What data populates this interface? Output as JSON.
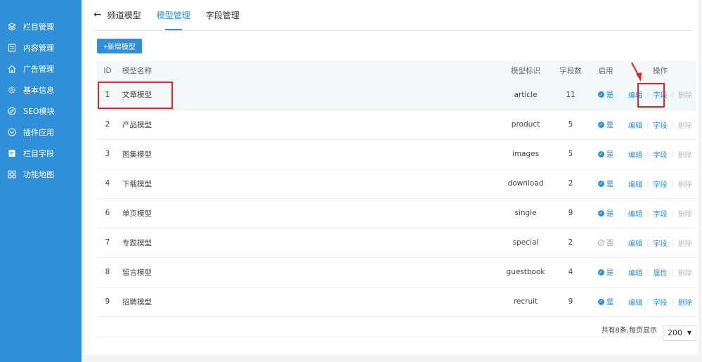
{
  "sidebar": {
    "items": [
      {
        "label": "栏目管理",
        "icon": "layers-icon"
      },
      {
        "label": "内容管理",
        "icon": "document-icon"
      },
      {
        "label": "广告管理",
        "icon": "home-icon"
      },
      {
        "label": "基本信息",
        "icon": "gear-icon"
      },
      {
        "label": "SEO模块",
        "icon": "compass-icon"
      },
      {
        "label": "插件应用",
        "icon": "plugin-icon"
      },
      {
        "label": "栏目字段",
        "icon": "file-icon"
      },
      {
        "label": "功能地图",
        "icon": "grid-icon"
      }
    ]
  },
  "header": {
    "back_label": "频道模型",
    "tabs": [
      {
        "label": "模型管理",
        "active": true
      },
      {
        "label": "字段管理",
        "active": false
      }
    ]
  },
  "toolbar": {
    "add_label": "+新增模型"
  },
  "table": {
    "columns": {
      "id": "ID",
      "name": "模型名称",
      "key": "模型标识",
      "count": "字段数",
      "enabled": "启用",
      "ops": "操作"
    },
    "rows": [
      {
        "id": "1",
        "name": "文章模型",
        "key": "article",
        "count": "11",
        "enabled": "是",
        "op1": "编辑",
        "op2": "字段",
        "op3": "删除"
      },
      {
        "id": "2",
        "name": "产品模型",
        "key": "product",
        "count": "5",
        "enabled": "是",
        "op1": "编辑",
        "op2": "字段",
        "op3": "删除"
      },
      {
        "id": "3",
        "name": "图集模型",
        "key": "images",
        "count": "5",
        "enabled": "是",
        "op1": "编辑",
        "op2": "字段",
        "op3": "删除"
      },
      {
        "id": "4",
        "name": "下载模型",
        "key": "download",
        "count": "2",
        "enabled": "是",
        "op1": "编辑",
        "op2": "字段",
        "op3": "删除"
      },
      {
        "id": "6",
        "name": "单页模型",
        "key": "single",
        "count": "9",
        "enabled": "是",
        "op1": "编辑",
        "op2": "字段",
        "op3": "删除"
      },
      {
        "id": "7",
        "name": "专题模型",
        "key": "special",
        "count": "2",
        "enabled": "否",
        "op1": "编辑",
        "op2": "字段",
        "op3": "删除"
      },
      {
        "id": "8",
        "name": "留言模型",
        "key": "guestbook",
        "count": "4",
        "enabled": "是",
        "op1": "编辑",
        "op2": "属性",
        "op3": "删除"
      },
      {
        "id": "9",
        "name": "招聘模型",
        "key": "recruit",
        "count": "9",
        "enabled": "是",
        "op1": "编辑",
        "op2": "字段",
        "op3": "删除"
      }
    ]
  },
  "footer": {
    "total_text": "共有8条,每页显示",
    "page_size": "200"
  },
  "colors": {
    "accent": "#2f8fd8",
    "sidebar": "#2f8fd8",
    "annotation": "#e0252b"
  }
}
